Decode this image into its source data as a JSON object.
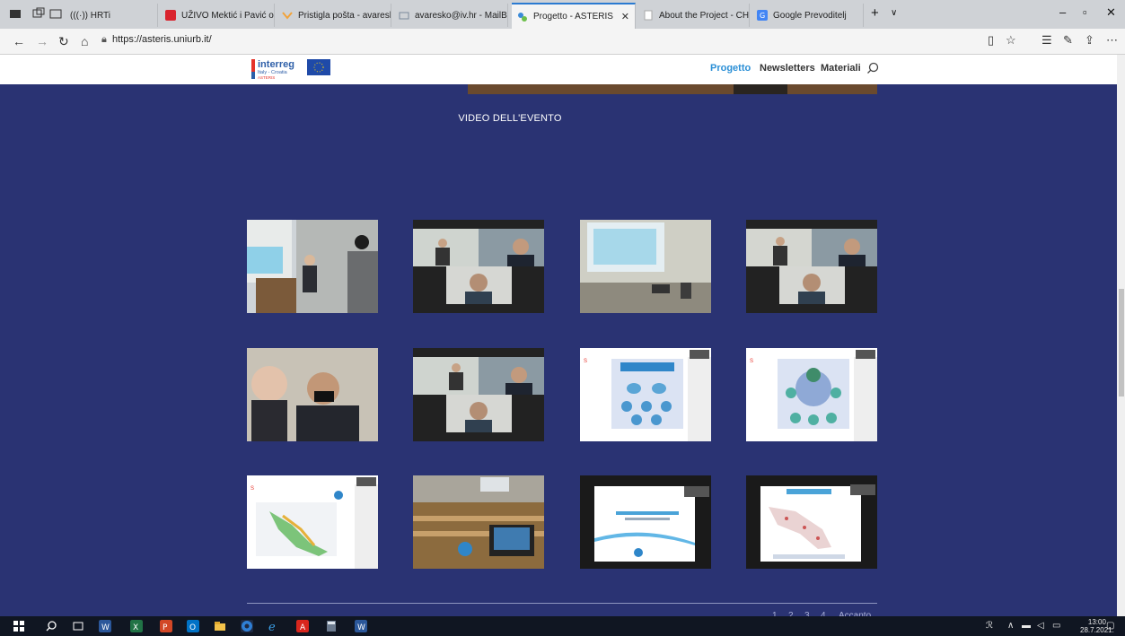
{
  "browser": {
    "tabs": [
      {
        "label": "(((·)) HRTi",
        "favicon_color": "#f0f0f0"
      },
      {
        "label": "UŽIVO Mektić i Pavić osigur",
        "favicon_color": "#d9232d"
      },
      {
        "label": "Pristigla pošta - avaresko@i",
        "favicon_color": "#f2a33a"
      },
      {
        "label": "avaresko@iv.hr - MailBox - I",
        "favicon_color": "#7b8a9c"
      },
      {
        "label": "Progetto - ASTERIS",
        "favicon_color": "#3b8bd8"
      },
      {
        "label": "About the Project - CHARGI",
        "favicon_color": "#ffffff"
      },
      {
        "label": "Google Prevoditelj",
        "favicon_color": "#4285f4"
      }
    ],
    "url": "https://asteris.uniurb.it/",
    "new_tab": "+",
    "tab_menu": "∨"
  },
  "site": {
    "logo_text": "interreg",
    "logo_sub": "Italy - Croatia",
    "logo_project": "ASTERIS",
    "nav": [
      {
        "label": "Progetto",
        "active": true
      },
      {
        "label": "Newsletters",
        "active": false
      },
      {
        "label": "Materiali",
        "active": false
      }
    ]
  },
  "content": {
    "section_title": "VIDEO DELL'EVENTO",
    "pagination": [
      "1",
      "2",
      "3",
      "4",
      "Accanto"
    ]
  },
  "taskbar": {
    "time": "13:00",
    "date": "28.7.2021."
  }
}
